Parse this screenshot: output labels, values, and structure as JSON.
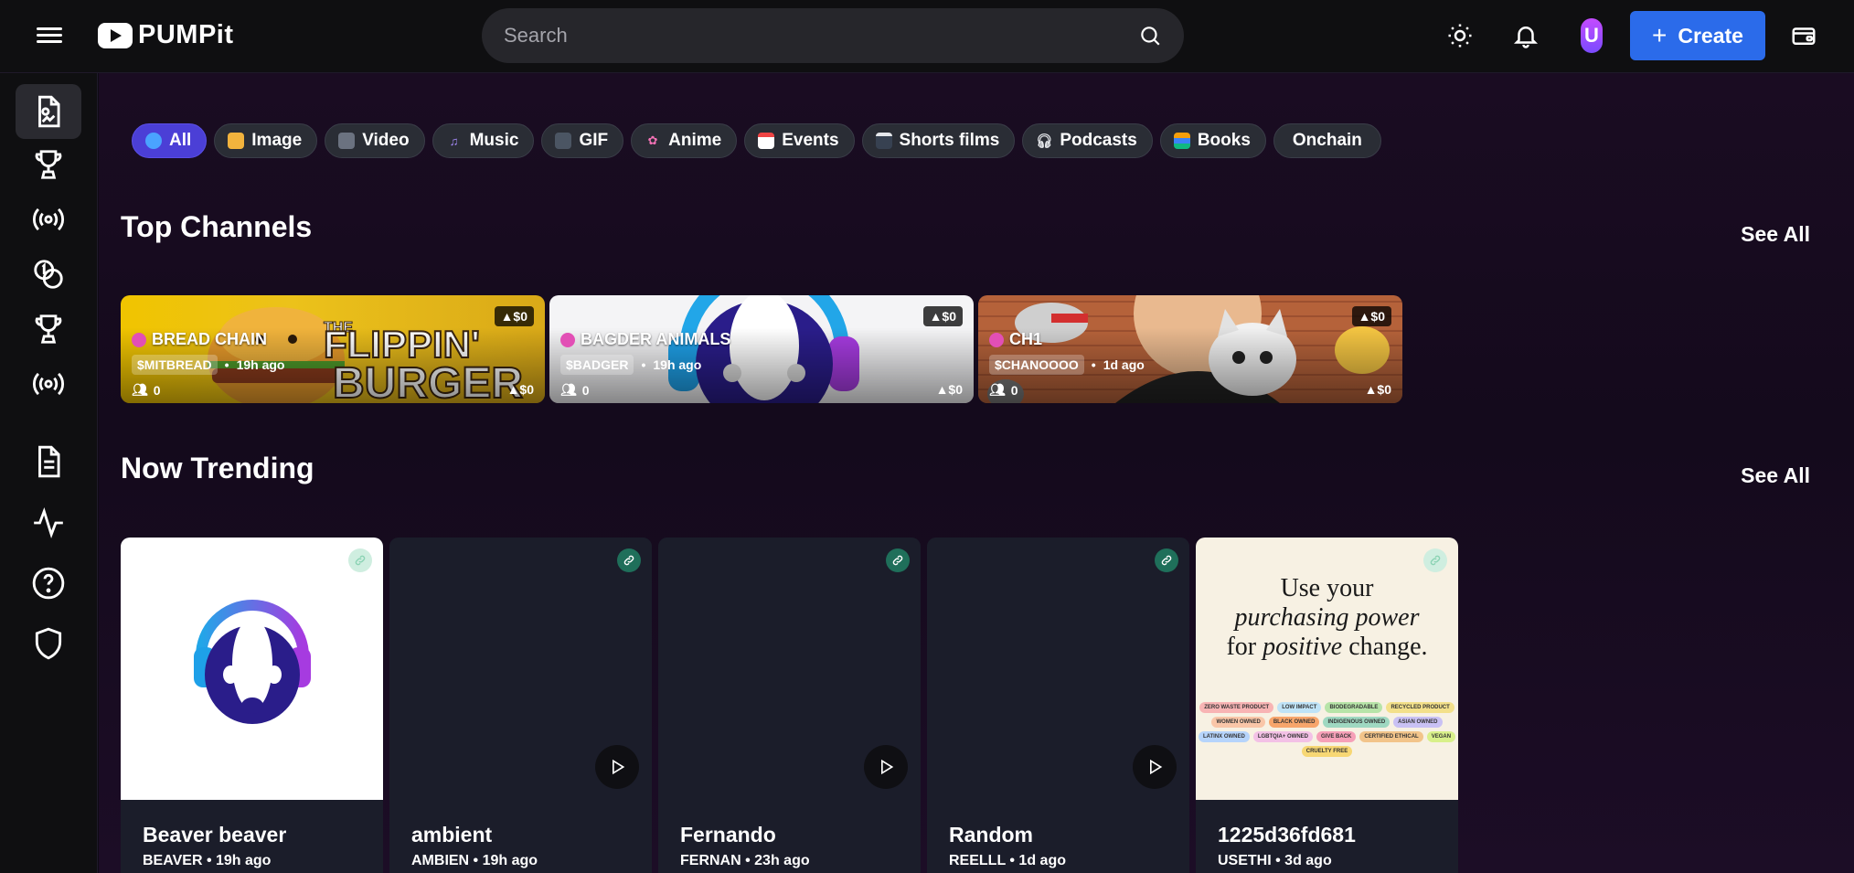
{
  "header": {
    "logo_text": "PUMPit",
    "search_placeholder": "Search",
    "create_label": "Create",
    "avatar_letter": "U"
  },
  "sidebar": {
    "items": [
      {
        "icon": "content-file-icon"
      },
      {
        "icon": "trophy-icon"
      },
      {
        "icon": "broadcast-icon"
      },
      {
        "icon": "coins-icon"
      },
      {
        "icon": "trophy-icon"
      },
      {
        "icon": "broadcast-icon"
      },
      {
        "icon": "document-icon"
      },
      {
        "icon": "activity-icon"
      },
      {
        "icon": "help-icon"
      },
      {
        "icon": "shield-icon"
      }
    ]
  },
  "filters": [
    {
      "label": "All",
      "icon": "globe-icon",
      "color": "#4aa3ff"
    },
    {
      "label": "Image",
      "icon": "image-icon",
      "color": "#f2b33d"
    },
    {
      "label": "Video",
      "icon": "video-camera-icon",
      "color": "#9aa0a6"
    },
    {
      "label": "Music",
      "icon": "music-note-icon",
      "color": "#a78bfa"
    },
    {
      "label": "GIF",
      "icon": "gif-icon",
      "color": "#9aa0a6"
    },
    {
      "label": "Anime",
      "icon": "flower-icon",
      "color": "#f472b6"
    },
    {
      "label": "Events",
      "icon": "calendar-icon",
      "color": "#ef4444"
    },
    {
      "label": "Shorts films",
      "icon": "clapper-icon",
      "color": "#d1d5db"
    },
    {
      "label": "Podcasts",
      "icon": "headphones-icon",
      "color": "#d1d5db"
    },
    {
      "label": "Books",
      "icon": "books-icon",
      "color": "#f59e0b"
    },
    {
      "label": "Onchain",
      "icon": "",
      "color": ""
    }
  ],
  "top_channels": {
    "title": "Top Channels",
    "see_all": "See All",
    "items": [
      {
        "name": "BREAD CHAIN",
        "ticker": "$MITBREAD",
        "age": "19h ago",
        "members": "0",
        "price_top": "▲$0",
        "price_bottom": "▲$0"
      },
      {
        "name": "BAGDER ANIMALS",
        "ticker": "$BADGER",
        "age": "19h ago",
        "members": "0",
        "price_top": "▲$0",
        "price_bottom": "▲$0"
      },
      {
        "name": "CH1",
        "ticker": "$CHANOOOO",
        "age": "1d ago",
        "members": "0",
        "price_top": "▲$0",
        "price_bottom": "▲$0"
      }
    ]
  },
  "now_trending": {
    "title": "Now Trending",
    "see_all": "See All",
    "items": [
      {
        "title": "Beaver beaver",
        "meta": "BEAVER • 19h ago",
        "thumb": "badger-logo"
      },
      {
        "title": "ambient",
        "meta": "AMBIEN • 19h ago",
        "thumb": "video"
      },
      {
        "title": "Fernando",
        "meta": "FERNAN • 23h ago",
        "thumb": "video"
      },
      {
        "title": "Random",
        "meta": "REELLL • 1d ago",
        "thumb": "video"
      },
      {
        "title": "1225d36fd681",
        "meta": "USETHI • 3d ago",
        "thumb": "poster"
      }
    ]
  },
  "poster": {
    "line1": "Use your",
    "line2": "purchasing power",
    "line3a": "for ",
    "line3b": "positive",
    "line3c": " change.",
    "tags": [
      "ZERO WASTE PRODUCT",
      "LOW IMPACT",
      "BIODEGRADABLE",
      "RECYCLED PRODUCT",
      "WOMEN OWNED",
      "BLACK OWNED",
      "INDIGENOUS OWNED",
      "ASIAN OWNED",
      "LATINX OWNED",
      "LGBTQIA+ OWNED",
      "GIVE BACK",
      "CERTIFIED ETHICAL",
      "VEGAN",
      "CRUELTY FREE"
    ]
  },
  "colors": {
    "accent": "#2b6bea",
    "chip_active": "#4b3fd6",
    "link_badge": "#1f6f5a"
  }
}
